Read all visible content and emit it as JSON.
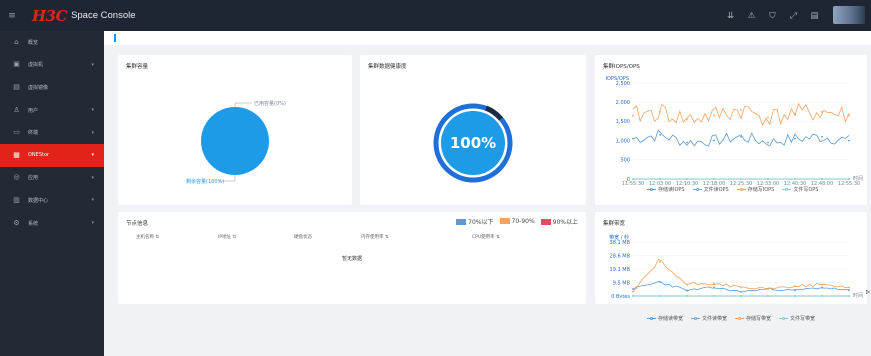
{
  "header": {
    "logo_text": "H3C",
    "app_name": "Space Console",
    "icons": [
      "menu-toggle-icon",
      "download-icon",
      "alert-icon",
      "shield-icon",
      "fullscreen-icon",
      "calendar-icon"
    ]
  },
  "sidebar": {
    "items": [
      {
        "label": "概览",
        "icon": "⌂",
        "has_arrow": false
      },
      {
        "label": "虚拟机",
        "icon": "▣",
        "has_arrow": true
      },
      {
        "label": "虚拟镜像",
        "icon": "▤",
        "has_arrow": false
      },
      {
        "label": "用户",
        "icon": "♙",
        "has_arrow": true
      },
      {
        "label": "终端",
        "icon": "▭",
        "has_arrow": true
      },
      {
        "label": "ONEStor",
        "icon": "▦",
        "has_arrow": true,
        "active": true
      },
      {
        "label": "应用",
        "icon": "◎",
        "has_arrow": true
      },
      {
        "label": "数据中心",
        "icon": "▥",
        "has_arrow": true
      },
      {
        "label": "系统",
        "icon": "⚙",
        "has_arrow": true
      }
    ]
  },
  "capacity_card": {
    "title": "集群容量",
    "used_label": "已用容量(0%)",
    "free_label": "剩余容量(100%)"
  },
  "health_card": {
    "title": "集群数据健康度",
    "value": "100%"
  },
  "iops_card": {
    "title": "集群IOPS/OPS",
    "unit_label": "IOPS/OPS",
    "x_axis_suffix": "时间",
    "legend": [
      "存储读IOPS",
      "文件读OPS",
      "存储写IOPS",
      "文件写OPS"
    ]
  },
  "node_card": {
    "title": "节点信息",
    "legend": [
      {
        "label": "70%以下",
        "color": "#5b9bd5"
      },
      {
        "label": "70-90%",
        "color": "#f4a460"
      },
      {
        "label": "90%以上",
        "color": "#e84a5f"
      }
    ],
    "columns": [
      "主机名称 ⇅",
      "IP地址 ⇅",
      "硬盘状态",
      "内存使用率 ⇅",
      "CPU使用率 ⇅"
    ],
    "empty_text": "暂无数据"
  },
  "bw_card": {
    "title": "集群带宽",
    "unit_label": "带宽 / 秒",
    "x_axis_suffix": "时间",
    "legend": [
      "存储读带宽",
      "文件读带宽",
      "存储写带宽",
      "文件写带宽"
    ]
  },
  "colors": {
    "storage_read": "#5b9bd5",
    "file_read": "#6fa8dc",
    "storage_write": "#f4a460",
    "file_write": "#7fd3c9",
    "active_red": "#e2231a",
    "pie_blue": "#1e9be6"
  },
  "chart_data": [
    {
      "type": "pie",
      "title": "集群容量",
      "slices": [
        {
          "label": "已用容量(0%)",
          "value": 0
        },
        {
          "label": "剩余容量(100%)",
          "value": 100
        }
      ]
    },
    {
      "type": "line",
      "title": "集群IOPS/OPS",
      "ylabel": "IOPS/OPS",
      "y_ticks": [
        "2,500",
        "2,000",
        "1,500",
        "1,000",
        "500",
        "0"
      ],
      "ylim": [
        0,
        2500
      ],
      "x": [
        "11:55:30",
        "12:03:00",
        "12:10:30",
        "12:18:00",
        "12:25:30",
        "12:33:00",
        "12:40:30",
        "12:48:00",
        "12:55:30"
      ],
      "series": [
        {
          "name": "存储读IOPS",
          "values": [
            1050,
            1150,
            950,
            1000,
            1100,
            950,
            1050,
            1100,
            1000
          ]
        },
        {
          "name": "文件读OPS",
          "values": [
            0,
            0,
            0,
            0,
            0,
            0,
            0,
            0,
            0
          ]
        },
        {
          "name": "存储写IOPS",
          "values": [
            1650,
            1750,
            1550,
            1650,
            1800,
            1600,
            1700,
            1750,
            1650
          ]
        },
        {
          "name": "文件写OPS",
          "values": [
            0,
            0,
            0,
            0,
            0,
            0,
            0,
            0,
            0
          ]
        }
      ]
    },
    {
      "type": "line",
      "title": "集群带宽",
      "ylabel": "带宽 / 秒",
      "y_ticks": [
        "38.1 MB",
        "28.6 MB",
        "19.1 MB",
        "9.5 MB",
        "0 Bytes"
      ],
      "ylim": [
        0,
        38.1
      ],
      "x": [
        "11:55:30",
        "12:03:00",
        "12:10:30",
        "12:18:00",
        "12:25:30",
        "12:33:00",
        "12:40:30",
        "12:48:00",
        "12:55:30"
      ],
      "series": [
        {
          "name": "存储读带宽",
          "values": [
            5,
            10,
            4,
            6,
            3,
            5,
            4,
            6,
            4
          ]
        },
        {
          "name": "文件读带宽",
          "values": [
            0,
            0,
            0,
            0,
            0,
            0,
            0,
            0,
            0
          ]
        },
        {
          "name": "存储写带宽",
          "values": [
            3,
            24,
            8,
            9,
            6,
            5,
            7,
            8,
            6
          ]
        },
        {
          "name": "文件写带宽",
          "values": [
            0,
            0,
            0,
            0,
            0,
            0,
            0,
            0,
            0
          ]
        }
      ]
    }
  ]
}
